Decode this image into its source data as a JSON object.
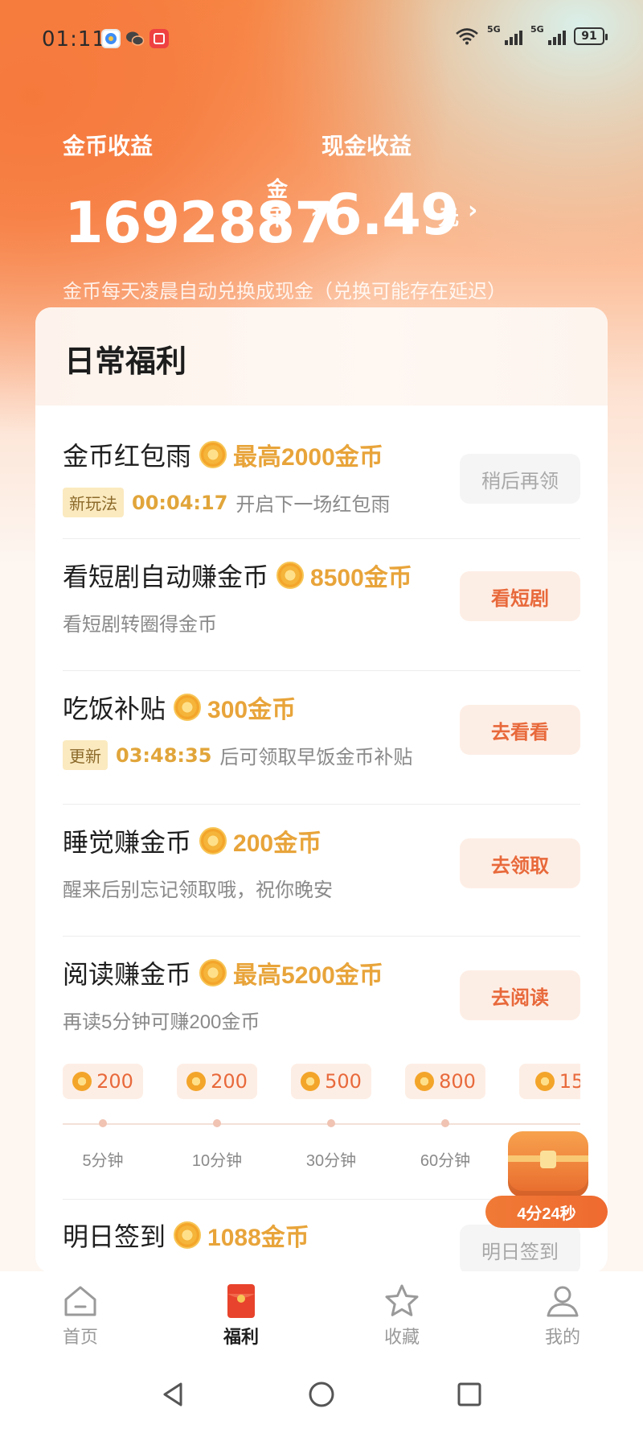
{
  "status_bar": {
    "time": "01:11",
    "net1": "5G",
    "net2": "5G",
    "battery": "91"
  },
  "earnings": {
    "coin_label": "金币收益",
    "coin_value": "1692887",
    "coin_unit_1": "金",
    "coin_unit_2": "币",
    "cash_label": "现金收益",
    "cash_value": "6.49",
    "cash_unit": "元",
    "note": "金币每天凌晨自动兑换成现金（兑换可能存在延迟）"
  },
  "card": {
    "title": "日常福利",
    "tasks": [
      {
        "title": "金币红包雨",
        "reward": "最高2000金币",
        "badge": "新玩法",
        "countdown": "00:04:17",
        "sub": "开启下一场红包雨",
        "button": "稍后再领"
      },
      {
        "title": "看短剧自动赚金币",
        "reward": "8500金币",
        "sub": "看短剧转圈得金币",
        "button": "看短剧"
      },
      {
        "title": "吃饭补贴",
        "reward": "300金币",
        "badge": "更新",
        "countdown": "03:48:35",
        "sub": "后可领取早饭金币补贴",
        "button": "去看看"
      },
      {
        "title": "睡觉赚金币",
        "reward": "200金币",
        "sub": "醒来后别忘记领取哦，祝你晚安",
        "button": "去领取"
      },
      {
        "title": "阅读赚金币",
        "reward": "最高5200金币",
        "sub": "再读5分钟可赚200金币",
        "button": "去阅读"
      },
      {
        "title": "明日签到",
        "reward": "1088金币",
        "button": "明日签到"
      }
    ],
    "reading_progress": [
      {
        "amount": "200",
        "label": "5分钟"
      },
      {
        "amount": "200",
        "label": "10分钟"
      },
      {
        "amount": "500",
        "label": "30分钟"
      },
      {
        "amount": "800",
        "label": "60分钟"
      },
      {
        "amount": "15",
        "label": ""
      }
    ]
  },
  "chest": {
    "timer": "4分24秒"
  },
  "bottom_nav": [
    {
      "label": "首页",
      "icon": "home-icon"
    },
    {
      "label": "福利",
      "icon": "red-packet-icon",
      "active": true
    },
    {
      "label": "收藏",
      "icon": "star-icon"
    },
    {
      "label": "我的",
      "icon": "user-icon"
    }
  ],
  "colors": {
    "accent": "#e8693b",
    "gold": "#e8a43a",
    "header_orange": "#f6793c"
  }
}
